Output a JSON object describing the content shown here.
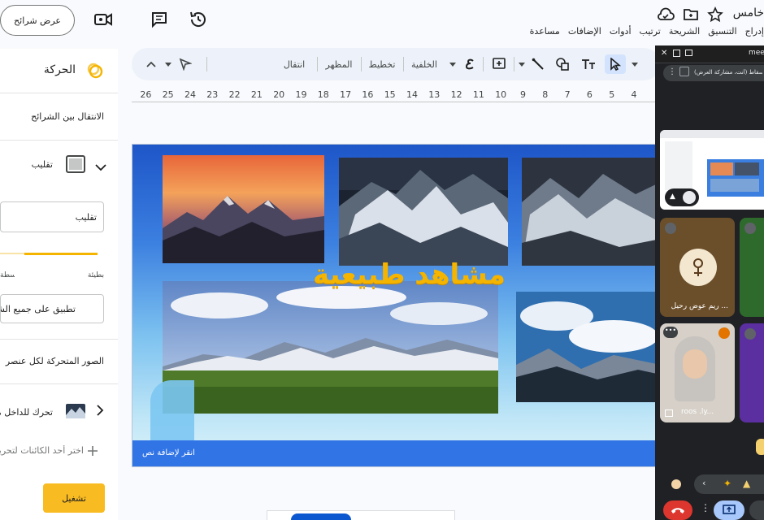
{
  "header": {
    "slideshow_label": "عرض شرائح",
    "doc_title_fragment": "خامس"
  },
  "menu": {
    "items": [
      "إدراج",
      "التنسيق",
      "الشريحة",
      "ترتيب",
      "أدوات",
      "الإضافات",
      "مساعدة"
    ]
  },
  "toolbar": {
    "transition_label": "انتقال",
    "theme_label": "المظهر",
    "layout_label": "تخطيط",
    "background_label": "الخلفية"
  },
  "ruler": {
    "ticks": [
      "4",
      "5",
      "6",
      "7",
      "8",
      "9",
      "10",
      "11",
      "12",
      "13",
      "14",
      "15",
      "16",
      "17",
      "18",
      "19",
      "20",
      "21",
      "22",
      "23",
      "24",
      "25",
      "26"
    ]
  },
  "slide": {
    "title": "مشاهد طبيعية",
    "caption_placeholder": "انقر لإضافة نص"
  },
  "motion_panel": {
    "title": "الحركة",
    "slide_transition_label": "الانتقال بين الشرائح",
    "transition_type": "تقليب",
    "dropdown_value": "تقليب",
    "speed_slow": "بطيئة",
    "speed_medium": "متوسطة",
    "apply_all_label": "تطبيق على جميع الشرائح",
    "object_animations_label": "الصور المتحركة لكل عنصر",
    "animation_item_label": "تحرك للداخل مع",
    "add_object_hint": "اختر أحد الكائنات لتحريكه",
    "play_label": "تشغيل",
    "speed_fraction": 0.75
  },
  "meet": {
    "window_title": "meet",
    "tab_caption": "(أنت، مشاركة العرض) وإسقاط",
    "participants": [
      {
        "name": "ريم عوض رحيل ..."
      },
      {
        "name": "roos .ly..."
      }
    ]
  },
  "colors": {
    "accent_blue": "#0b57d0",
    "play_yellow": "#f9bb22",
    "title_gold": "#f4b400",
    "meet_bg": "#202124"
  }
}
